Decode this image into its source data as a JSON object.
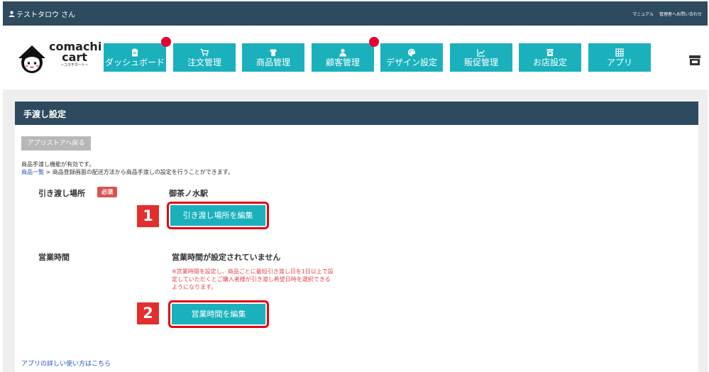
{
  "topbar": {
    "user_name": "テストタロウ さん",
    "links": [
      "マニュアル",
      "管理者へお問い合わせ"
    ]
  },
  "logo": {
    "line1": "comachi",
    "line2": "cart",
    "line3": "~コマチカート~"
  },
  "nav": [
    {
      "label": "ダッシュボード",
      "icon": "clipboard-icon",
      "badge": true
    },
    {
      "label": "注文管理",
      "icon": "cart-icon",
      "badge": false
    },
    {
      "label": "商品管理",
      "icon": "tshirt-icon",
      "badge": false
    },
    {
      "label": "顧客管理",
      "icon": "user-icon",
      "badge": true
    },
    {
      "label": "デザイン設定",
      "icon": "palette-icon",
      "badge": false
    },
    {
      "label": "販促管理",
      "icon": "chart-icon",
      "badge": false
    },
    {
      "label": "お店設定",
      "icon": "store-icon",
      "badge": false
    },
    {
      "label": "アプリ",
      "icon": "grid-icon",
      "badge": false
    }
  ],
  "panel": {
    "title": "手渡し設定",
    "back_label": "アプリストアへ戻る",
    "info_line1": "商品手渡し機能が有効です。",
    "info_link": "商品一覧",
    "info_line2_rest": " > 商品登録画面の配送方法から商品手渡しの設定を行うことができます。"
  },
  "handover": {
    "label": "引き渡し場所",
    "required": "必須",
    "value": "御茶ノ水駅",
    "button": "引き渡し場所を編集",
    "step": "1"
  },
  "hours": {
    "label": "営業時間",
    "value": "営業時間が設定されていません",
    "note": "※営業時間を設定し、商品ごとに最短引き渡し日を1日以上で設定していただくとご購入者様が引き渡し希望日時を選択できるようになります。",
    "button": "営業時間を編集",
    "step": "2"
  },
  "footer": {
    "link": "アプリの詳しい使い方はこちら"
  },
  "colors": {
    "header_dark": "#2e4a5e",
    "teal": "#1ab1bd",
    "badge_red": "#e60033",
    "highlight_red": "#e60012",
    "note_red": "#e9434c",
    "link_blue": "#2b52c7"
  }
}
